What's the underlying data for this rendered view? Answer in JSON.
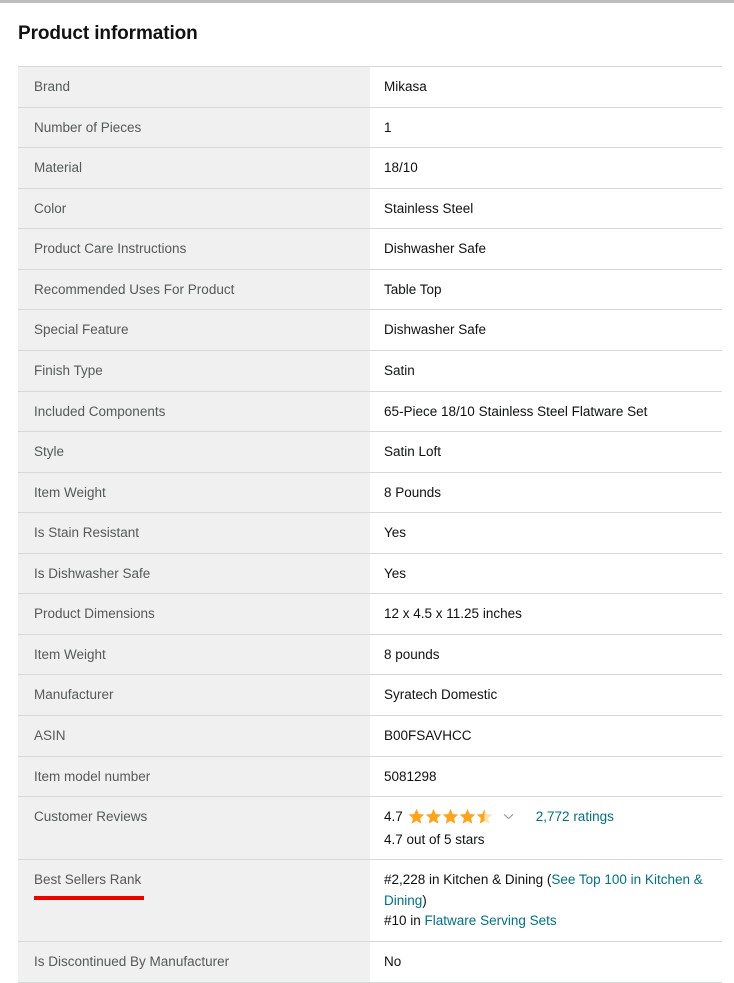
{
  "page": {
    "title": "Product information"
  },
  "table": {
    "rows": [
      {
        "label": "Brand",
        "value": "Mikasa"
      },
      {
        "label": "Number of Pieces",
        "value": "1"
      },
      {
        "label": "Material",
        "value": "18/10"
      },
      {
        "label": "Color",
        "value": "Stainless Steel"
      },
      {
        "label": "Product Care Instructions",
        "value": "Dishwasher Safe"
      },
      {
        "label": "Recommended Uses For Product",
        "value": "Table Top"
      },
      {
        "label": "Special Feature",
        "value": "Dishwasher Safe"
      },
      {
        "label": "Finish Type",
        "value": "Satin"
      },
      {
        "label": "Included Components",
        "value": "65-Piece 18/10 Stainless Steel Flatware Set"
      },
      {
        "label": "Style",
        "value": "Satin Loft"
      },
      {
        "label": "Item Weight",
        "value": "8 Pounds"
      },
      {
        "label": "Is Stain Resistant",
        "value": "Yes"
      },
      {
        "label": "Is Dishwasher Safe",
        "value": "Yes"
      },
      {
        "label": "Product Dimensions",
        "value": "12 x 4.5 x 11.25 inches"
      },
      {
        "label": "Item Weight",
        "value": "8 pounds"
      },
      {
        "label": "Manufacturer",
        "value": "Syratech Domestic"
      },
      {
        "label": "ASIN",
        "value": "B00FSAVHCC"
      },
      {
        "label": "Item model number",
        "value": "5081298"
      }
    ],
    "customer_reviews": {
      "label": "Customer Reviews",
      "rating_value": "4.7",
      "stars_filled": 4.5,
      "stars_total": 5,
      "star_color": "#FFA41C",
      "star_empty_color": "#FFD27A",
      "dropdown_icon": "chevron-down-icon",
      "ratings_count_label": "2,772 ratings",
      "out_of_label": "4.7 out of 5 stars"
    },
    "best_sellers_rank": {
      "label": "Best Sellers Rank",
      "annotation_color": "#ef0000",
      "line1_prefix": "#2,228 in Kitchen & Dining (",
      "line1_link": "See Top 100 in Kitchen & Dining",
      "line1_suffix": ")",
      "line2_prefix": "#10 in ",
      "line2_link": "Flatware Serving Sets"
    },
    "discontinued": {
      "label": "Is Discontinued By Manufacturer",
      "value": "No"
    }
  },
  "colors": {
    "label_bg": "#f0f0f0",
    "border": "#d5d9d9",
    "label_text": "#565959",
    "value_text": "#0f1111",
    "link": "#007185",
    "annotation_red": "#ef0000",
    "top_rule": "#bdbdbd"
  }
}
